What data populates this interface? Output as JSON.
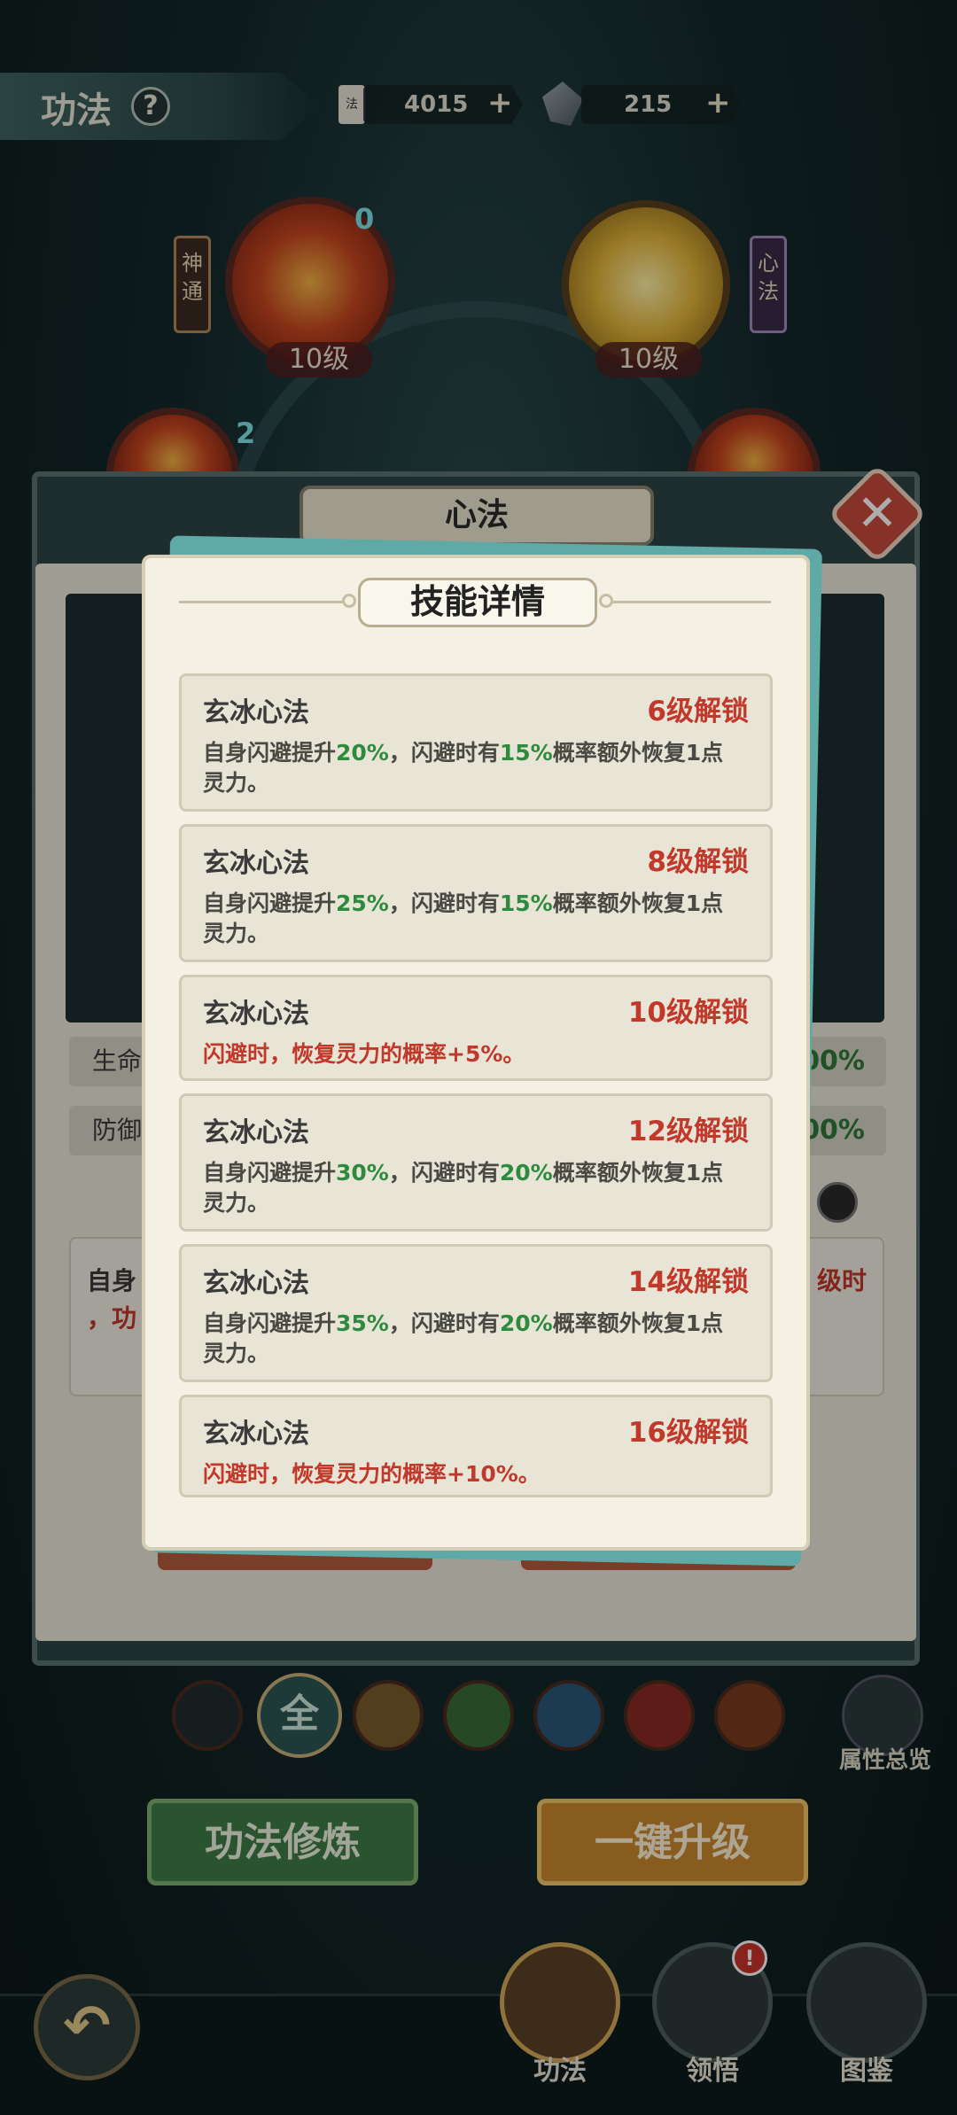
{
  "header": {
    "title": "功法",
    "help_icon": "?",
    "currencies": [
      {
        "icon_label": "法",
        "value": "4015",
        "plus": "+"
      },
      {
        "value": "215",
        "plus": "+"
      }
    ]
  },
  "wheel": {
    "left_tag": "神通",
    "right_tag": "心法",
    "orbs": [
      {
        "level": "10级",
        "badge": "0"
      },
      {
        "level": "10级"
      }
    ],
    "partial_badge": "2"
  },
  "panel": {
    "title": "心法",
    "stats": [
      {
        "label": "生命",
        "value": "00%"
      },
      {
        "label": "防御",
        "value": "00%"
      }
    ],
    "desc_left": "自身",
    "desc_left2": "，功",
    "desc_right": "级时"
  },
  "modal": {
    "title": "技能详情",
    "skills": [
      {
        "name": "玄冰心法",
        "unlock": "6级解锁",
        "desc_parts": [
          "自身闪避提升",
          "20%",
          "，闪避时有",
          "15%",
          "概率额外恢复1点灵力。"
        ]
      },
      {
        "name": "玄冰心法",
        "unlock": "8级解锁",
        "desc_parts": [
          "自身闪避提升",
          "25%",
          "，闪避时有",
          "15%",
          "概率额外恢复1点灵力。"
        ]
      },
      {
        "name": "玄冰心法",
        "unlock": "10级解锁",
        "desc_red": "闪避时，恢复灵力的概率+5%。"
      },
      {
        "name": "玄冰心法",
        "unlock": "12级解锁",
        "desc_parts": [
          "自身闪避提升",
          "30%",
          "，闪避时有",
          "20%",
          "概率额外恢复1点灵力。"
        ]
      },
      {
        "name": "玄冰心法",
        "unlock": "14级解锁",
        "desc_parts": [
          "自身闪避提升",
          "35%",
          "，闪避时有",
          "20%",
          "概率额外恢复1点灵力。"
        ]
      },
      {
        "name": "玄冰心法",
        "unlock": "16级解锁",
        "desc_red": "闪避时，恢复灵力的概率+10%。"
      }
    ]
  },
  "filters": {
    "all_label": "全",
    "attr_overview": "属性总览"
  },
  "actions": {
    "train": "功法修炼",
    "upgrade_all": "一键升级"
  },
  "nav": {
    "back_icon": "↶",
    "items": [
      {
        "label": "功法",
        "active": true
      },
      {
        "label": "领悟",
        "badge": "!"
      },
      {
        "label": "图鉴"
      }
    ]
  },
  "colors": {
    "unlock_red": "#c0392b",
    "value_green": "#2e8b3e",
    "modal_bg": "#f4f0e3"
  }
}
